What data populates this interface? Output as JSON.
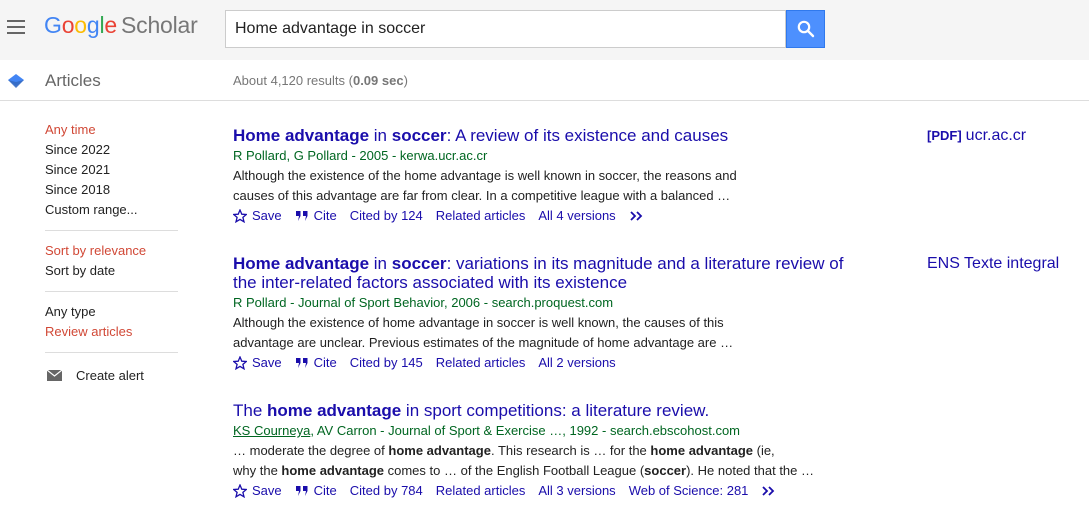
{
  "header": {
    "logo_google": [
      "G",
      "o",
      "o",
      "g",
      "l",
      "e"
    ],
    "logo_scholar": "Scholar",
    "search_value": "Home advantage in soccer"
  },
  "subheader": {
    "section_label": "Articles",
    "stats_prefix": "About 4,120 results (",
    "stats_time": "0.09 sec",
    "stats_suffix": ")"
  },
  "sidebar": {
    "time_filters": [
      {
        "label": "Any time",
        "active": true
      },
      {
        "label": "Since 2022",
        "active": false
      },
      {
        "label": "Since 2021",
        "active": false
      },
      {
        "label": "Since 2018",
        "active": false
      },
      {
        "label": "Custom range...",
        "active": false
      }
    ],
    "sort_filters": [
      {
        "label": "Sort by relevance",
        "active": true
      },
      {
        "label": "Sort by date",
        "active": false
      }
    ],
    "type_filters": [
      {
        "label": "Any type",
        "active": false
      },
      {
        "label": "Review articles",
        "active": true
      }
    ],
    "create_alert": "Create alert"
  },
  "results": [
    {
      "title_line1_segments": [
        {
          "text": "Home advantage",
          "bold": true
        },
        {
          "text": " in ",
          "bold": false
        },
        {
          "text": "soccer",
          "bold": true
        },
        {
          "text": ": A review of its existence and causes",
          "bold": false
        }
      ],
      "meta": "R Pollard, G Pollard - 2005 - kerwa.ucr.ac.cr",
      "snippet_line1": "Although the existence of the home advantage is well known in soccer, the reasons and",
      "snippet_line2": "causes of this advantage are far from clear. In a competitive league with a balanced …",
      "actions": {
        "save": "Save",
        "cite": "Cite",
        "cited_by": "Cited by 124",
        "related": "Related articles",
        "versions": "All 4 versions"
      },
      "side_tag": "[PDF]",
      "side_link": "ucr.ac.cr"
    },
    {
      "title_line1_segments": [
        {
          "text": "Home advantage",
          "bold": true
        },
        {
          "text": " in ",
          "bold": false
        },
        {
          "text": "soccer",
          "bold": true
        },
        {
          "text": ": variations in its magnitude and a literature review of",
          "bold": false
        }
      ],
      "title_line2": "the inter-related factors associated with its existence",
      "meta": "R Pollard - Journal of Sport Behavior, 2006 - search.proquest.com",
      "snippet_line1": "Although the existence of home advantage in soccer is well known, the causes of this",
      "snippet_line2": "advantage are unclear. Previous estimates of the magnitude of home advantage are …",
      "actions": {
        "save": "Save",
        "cite": "Cite",
        "cited_by": "Cited by 145",
        "related": "Related articles",
        "versions": "All 2 versions"
      },
      "side_link": "ENS Texte integral"
    },
    {
      "title_line1_segments": [
        {
          "text": "The ",
          "bold": false
        },
        {
          "text": "home advantage",
          "bold": true
        },
        {
          "text": " in sport competitions: a literature review.",
          "bold": false
        }
      ],
      "meta_author": "KS Courneya",
      "meta_rest": ", AV Carron - Journal of Sport & Exercise …, 1992 - search.ebscohost.com",
      "snippet_line1_segments": [
        {
          "text": "… moderate the degree of ",
          "bold": false
        },
        {
          "text": "home advantage",
          "bold": true
        },
        {
          "text": ". This research is … for the ",
          "bold": false
        },
        {
          "text": "home advantage",
          "bold": true
        },
        {
          "text": " (ie,",
          "bold": false
        }
      ],
      "snippet_line2_segments": [
        {
          "text": "why the ",
          "bold": false
        },
        {
          "text": "home advantage",
          "bold": true
        },
        {
          "text": " comes to … of the English Football League (",
          "bold": false
        },
        {
          "text": "soccer",
          "bold": true
        },
        {
          "text": "). He noted that the …",
          "bold": false
        }
      ],
      "actions": {
        "save": "Save",
        "cite": "Cite",
        "cited_by": "Cited by 784",
        "related": "Related articles",
        "versions": "All 3 versions",
        "wos": "Web of Science: 281"
      }
    }
  ]
}
